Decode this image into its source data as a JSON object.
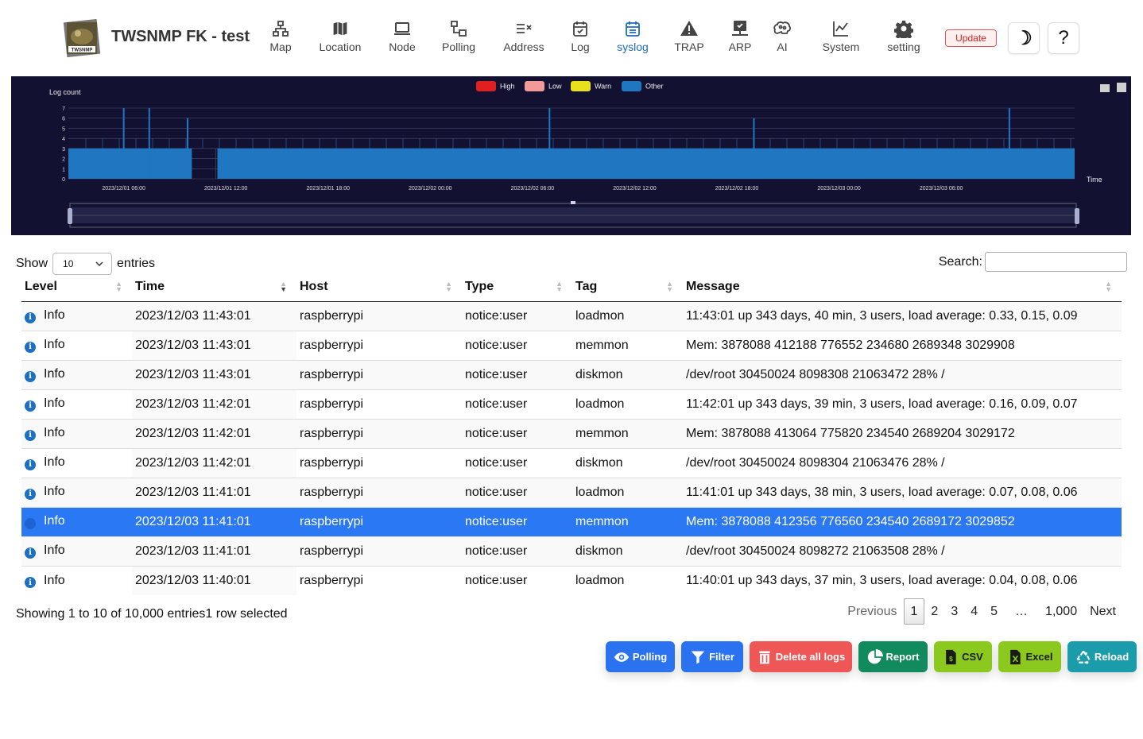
{
  "app": {
    "title": "TWSNMP FK - test",
    "logo_text": "TWSNMP"
  },
  "nav": [
    {
      "label": "Map",
      "icon": "network-icon"
    },
    {
      "label": "Location",
      "icon": "map-icon"
    },
    {
      "label": "Node",
      "icon": "laptop-icon"
    },
    {
      "label": "Polling",
      "icon": "polling-icon"
    },
    {
      "label": "Address",
      "icon": "address-icon"
    },
    {
      "label": "Log",
      "icon": "calendar-check-icon"
    },
    {
      "label": "syslog",
      "icon": "calendar-list-icon",
      "active": true
    },
    {
      "label": "TRAP",
      "icon": "warning-icon"
    },
    {
      "label": "ARP",
      "icon": "arp-icon"
    },
    {
      "label": "AI",
      "icon": "brain-icon"
    },
    {
      "label": "System",
      "icon": "chart-line-icon"
    },
    {
      "label": "setting",
      "icon": "gear-icon"
    }
  ],
  "header_buttons": {
    "update": "Update",
    "theme_icon": "☽",
    "help_icon": "?"
  },
  "chart_data": {
    "type": "bar",
    "ylabel": "Log count",
    "xlabel": "Time",
    "yticks": [
      "0",
      "1",
      "2",
      "3",
      "4",
      "5",
      "6",
      "7"
    ],
    "ylim": [
      0,
      7
    ],
    "xticks": [
      "2023/12/01 06:00",
      "2023/12/01 12:00",
      "2023/12/01 18:00",
      "2023/12/02 00:00",
      "2023/12/02 06:00",
      "2023/12/02 12:00",
      "2023/12/02 18:00",
      "2023/12/03 00:00",
      "2023/12/03 06:00"
    ],
    "legend": [
      {
        "name": "High",
        "color": "#e01f1f"
      },
      {
        "name": "Low",
        "color": "#f29a9a"
      },
      {
        "name": "Warn",
        "color": "#e8e01a"
      },
      {
        "name": "Other",
        "color": "#1f77c2"
      }
    ],
    "legend_position": "top-center",
    "baseline_value": 3,
    "gap_range": [
      "2023/12/01 10:00",
      "2023/12/01 11:30"
    ],
    "spikes": [
      {
        "time": "2023/12/01 06:00",
        "value": 7
      },
      {
        "time": "2023/12/01 07:30",
        "value": 7
      },
      {
        "time": "2023/12/01 09:45",
        "value": 6
      },
      {
        "time": "2023/12/02 07:00",
        "value": 7
      },
      {
        "time": "2023/12/02 19:00",
        "value": 6
      },
      {
        "time": "2023/12/03 10:00",
        "value": 7
      }
    ],
    "grid": true
  },
  "table": {
    "show_label": "Show",
    "entries_label": "entries",
    "page_size": "10",
    "search_label": "Search:",
    "search_value": "",
    "columns": [
      "Level",
      "Time",
      "Host",
      "Type",
      "Tag",
      "Message"
    ],
    "rows": [
      {
        "level": "Info",
        "time": "2023/12/03 11:43:01",
        "host": "raspberrypi",
        "type": "notice:user",
        "tag": "loadmon",
        "message": "11:43:01 up 343 days, 40 min, 3 users, load average: 0.33, 0.15, 0.09"
      },
      {
        "level": "Info",
        "time": "2023/12/03 11:43:01",
        "host": "raspberrypi",
        "type": "notice:user",
        "tag": "memmon",
        "message": "Mem: 3878088 412188 776552 234680 2689348 3029908"
      },
      {
        "level": "Info",
        "time": "2023/12/03 11:43:01",
        "host": "raspberrypi",
        "type": "notice:user",
        "tag": "diskmon",
        "message": "/dev/root 30450024 8098308 21063472 28% /"
      },
      {
        "level": "Info",
        "time": "2023/12/03 11:42:01",
        "host": "raspberrypi",
        "type": "notice:user",
        "tag": "loadmon",
        "message": "11:42:01 up 343 days, 39 min, 3 users, load average: 0.16, 0.09, 0.07"
      },
      {
        "level": "Info",
        "time": "2023/12/03 11:42:01",
        "host": "raspberrypi",
        "type": "notice:user",
        "tag": "memmon",
        "message": "Mem: 3878088 413064 775820 234540 2689204 3029172"
      },
      {
        "level": "Info",
        "time": "2023/12/03 11:42:01",
        "host": "raspberrypi",
        "type": "notice:user",
        "tag": "diskmon",
        "message": "/dev/root 30450024 8098304 21063476 28% /"
      },
      {
        "level": "Info",
        "time": "2023/12/03 11:41:01",
        "host": "raspberrypi",
        "type": "notice:user",
        "tag": "loadmon",
        "message": "11:41:01 up 343 days, 38 min, 3 users, load average: 0.07, 0.08, 0.06"
      },
      {
        "level": "Info",
        "time": "2023/12/03 11:41:01",
        "host": "raspberrypi",
        "type": "notice:user",
        "tag": "memmon",
        "message": "Mem: 3878088 412356 776560 234540 2689172 3029852",
        "selected": true
      },
      {
        "level": "Info",
        "time": "2023/12/03 11:41:01",
        "host": "raspberrypi",
        "type": "notice:user",
        "tag": "diskmon",
        "message": "/dev/root 30450024 8098272 21063508 28% /"
      },
      {
        "level": "Info",
        "time": "2023/12/03 11:40:01",
        "host": "raspberrypi",
        "type": "notice:user",
        "tag": "loadmon",
        "message": "11:40:01 up 343 days, 37 min, 3 users, load average: 0.04, 0.08, 0.06"
      }
    ],
    "info": "Showing 1 to 10 of 10,000 entries1 row selected",
    "pagination": {
      "previous": "Previous",
      "pages": [
        "1",
        "2",
        "3",
        "4",
        "5",
        "…",
        "1,000"
      ],
      "current": "1",
      "next": "Next"
    }
  },
  "actions": [
    {
      "label": "Polling",
      "icon": "eye-icon",
      "color": "#2b72f0"
    },
    {
      "label": "Filter",
      "icon": "filter-icon",
      "color": "#2b72f0"
    },
    {
      "label": "Delete all logs",
      "icon": "trash-icon",
      "color": "#ef5757"
    },
    {
      "label": "Report",
      "icon": "pie-chart-icon",
      "color": "#118a5e"
    },
    {
      "label": "CSV",
      "icon": "csv-file-icon",
      "color": "#8cc91e"
    },
    {
      "label": "Excel",
      "icon": "excel-file-icon",
      "color": "#8cc91e"
    },
    {
      "label": "Reload",
      "icon": "recycle-icon",
      "color": "#1a9cab"
    }
  ]
}
